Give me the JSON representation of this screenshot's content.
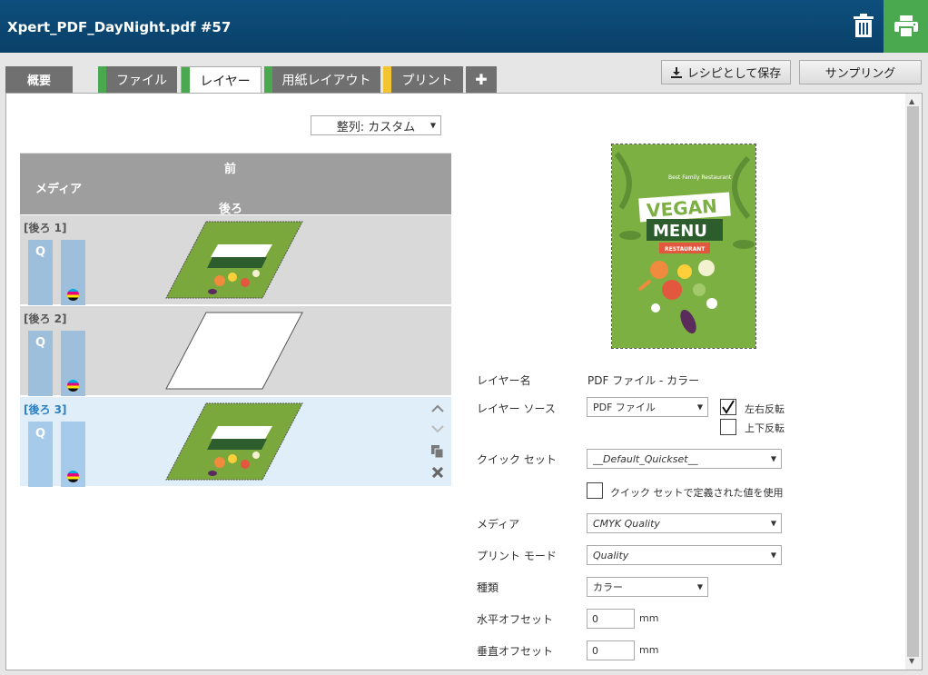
{
  "header": {
    "title": "Xpert_PDF_DayNight.pdf #57"
  },
  "tabs": [
    {
      "label": "概要"
    },
    {
      "label": "ファイル",
      "color": "#4aa84e"
    },
    {
      "label": "レイヤー",
      "color": "#4aa84e"
    },
    {
      "label": "用紙レイアウト",
      "color": "#4aa84e"
    },
    {
      "label": "プリント",
      "color": "#f2c431"
    }
  ],
  "add_tab_symbol": "✚",
  "active_tab": "レイヤー",
  "toolbar": {
    "save_recipe": "レシピとして保存",
    "sampling": "サンプリング"
  },
  "sort": {
    "value": "整列: カスタム"
  },
  "layer_table": {
    "front": "前",
    "media": "メディア",
    "back": "後ろ"
  },
  "layers": [
    {
      "label": "[後ろ 1]",
      "q": "Q",
      "thumbnail": "vegan-menu"
    },
    {
      "label": "[後ろ 2]",
      "q": "Q",
      "thumbnail": "blank"
    },
    {
      "label": "[後ろ 3]",
      "q": "Q",
      "thumbnail": "vegan-menu",
      "selected": true
    }
  ],
  "preview": {
    "subtitle": "Best Family Restaurant",
    "title1": "VEGAN",
    "title2": "MENU",
    "tag": "RESTAURANT"
  },
  "form": {
    "layer_name_label": "レイヤー名",
    "layer_name_value": "PDF ファイル - カラー",
    "layer_source_label": "レイヤー ソース",
    "layer_source_value": "PDF ファイル",
    "flip_h_label": "左右反転",
    "flip_h_checked": true,
    "flip_v_label": "上下反転",
    "flip_v_checked": false,
    "quickset_label": "クイック セット",
    "quickset_value": "__Default_Quickset__",
    "use_quickset_label": "クイック セットで定義された値を使用",
    "media_label": "メディア",
    "media_value": "CMYK Quality",
    "print_mode_label": "プリント モード",
    "print_mode_value": "Quality",
    "type_label": "種類",
    "type_value": "カラー",
    "h_offset_label": "水平オフセット",
    "h_offset_value": "0",
    "v_offset_label": "垂直オフセット",
    "v_offset_value": "0",
    "unit": "mm"
  },
  "colors": {
    "header": "#0b4a76",
    "print_button": "#4aa84e",
    "tab_green": "#4aa84e",
    "tab_yellow": "#f2c431",
    "bar_blue": "#9dbfdb",
    "selected_row": "#dfeef9"
  }
}
